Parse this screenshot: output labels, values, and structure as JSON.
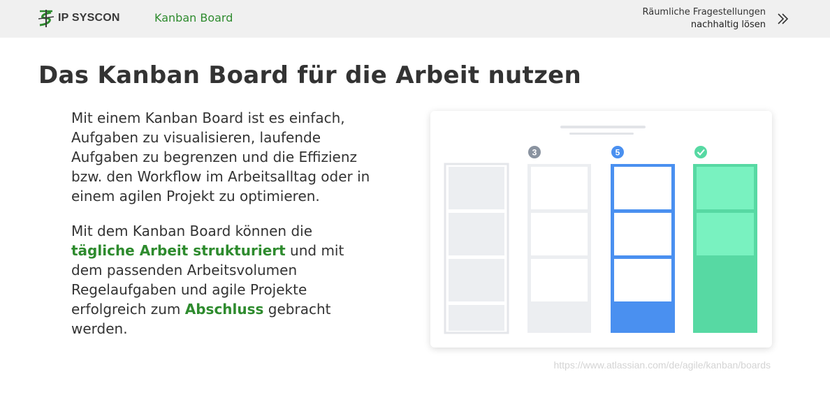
{
  "header": {
    "logo_text": "IP SYSCON",
    "nav_title": "Kanban Board",
    "tagline_line1": "Räumliche Fragestellungen",
    "tagline_line2": "nachhaltig lösen"
  },
  "page": {
    "heading": "Das Kanban Board für die Arbeit nutzen",
    "paragraph1": "Mit einem Kanban Board ist es einfach, Aufgaben zu visualisieren, laufende Aufgaben zu begrenzen und die Effizienz bzw. den Workflow im Arbeitsalltag oder in einem agilen Projekt zu optimieren.",
    "p2_part1": "Mit dem Kanban Board können die ",
    "p2_highlight1": "tägliche Arbeit strukturiert",
    "p2_part2": " und mit dem passenden Arbeitsvolumen Regelaufgaben und agile Projekte erfolgreich zum ",
    "p2_highlight2": "Abschluss",
    "p2_part3": " gebracht werden."
  },
  "illustration": {
    "badge_gray": "3",
    "badge_blue": "5",
    "color_gray_col": "#eceef1",
    "color_blue": "#4a90f0",
    "color_green": "#57d9a3",
    "color_green_light": "#79f2c0"
  },
  "source": {
    "text": "https://www.atlassian.com/de/agile/kanban/boards"
  },
  "colors": {
    "accent_green": "#2e8b2e",
    "topbar_bg": "#f0f0f0"
  }
}
